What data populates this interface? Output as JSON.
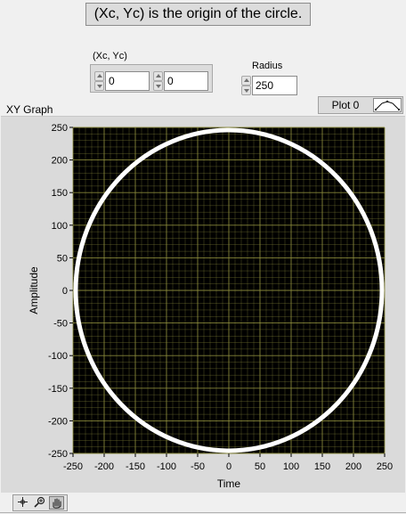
{
  "note": {
    "text": "(Xc, Yc) is the origin of the circle."
  },
  "origin_control": {
    "label": "(Xc, Yc)",
    "xc_value": "0",
    "yc_value": "0"
  },
  "radius_control": {
    "label": "Radius",
    "value": "250"
  },
  "graph": {
    "caption": "XY Graph",
    "legend": {
      "plot_name": "Plot 0"
    },
    "palette": {
      "tools": [
        "cursor-move-icon",
        "zoom-icon",
        "pan-hand-icon"
      ]
    }
  },
  "chart_data": {
    "type": "scatter",
    "xlabel": "Time",
    "ylabel": "Amplitude",
    "xlim": [
      -250,
      250
    ],
    "ylim": [
      -250,
      250
    ],
    "x_ticks": [
      -250,
      -200,
      -150,
      -100,
      -50,
      0,
      50,
      100,
      150,
      200,
      250
    ],
    "y_ticks": [
      -250,
      -200,
      -150,
      -100,
      -50,
      0,
      50,
      100,
      150,
      200,
      250
    ],
    "grid": true,
    "background_color": "#000000",
    "grid_color": "#8c8c3c",
    "series": [
      {
        "name": "Plot 0",
        "shape": "circle",
        "center": [
          0,
          0
        ],
        "radius": 250,
        "color": "#ffffff"
      }
    ]
  }
}
